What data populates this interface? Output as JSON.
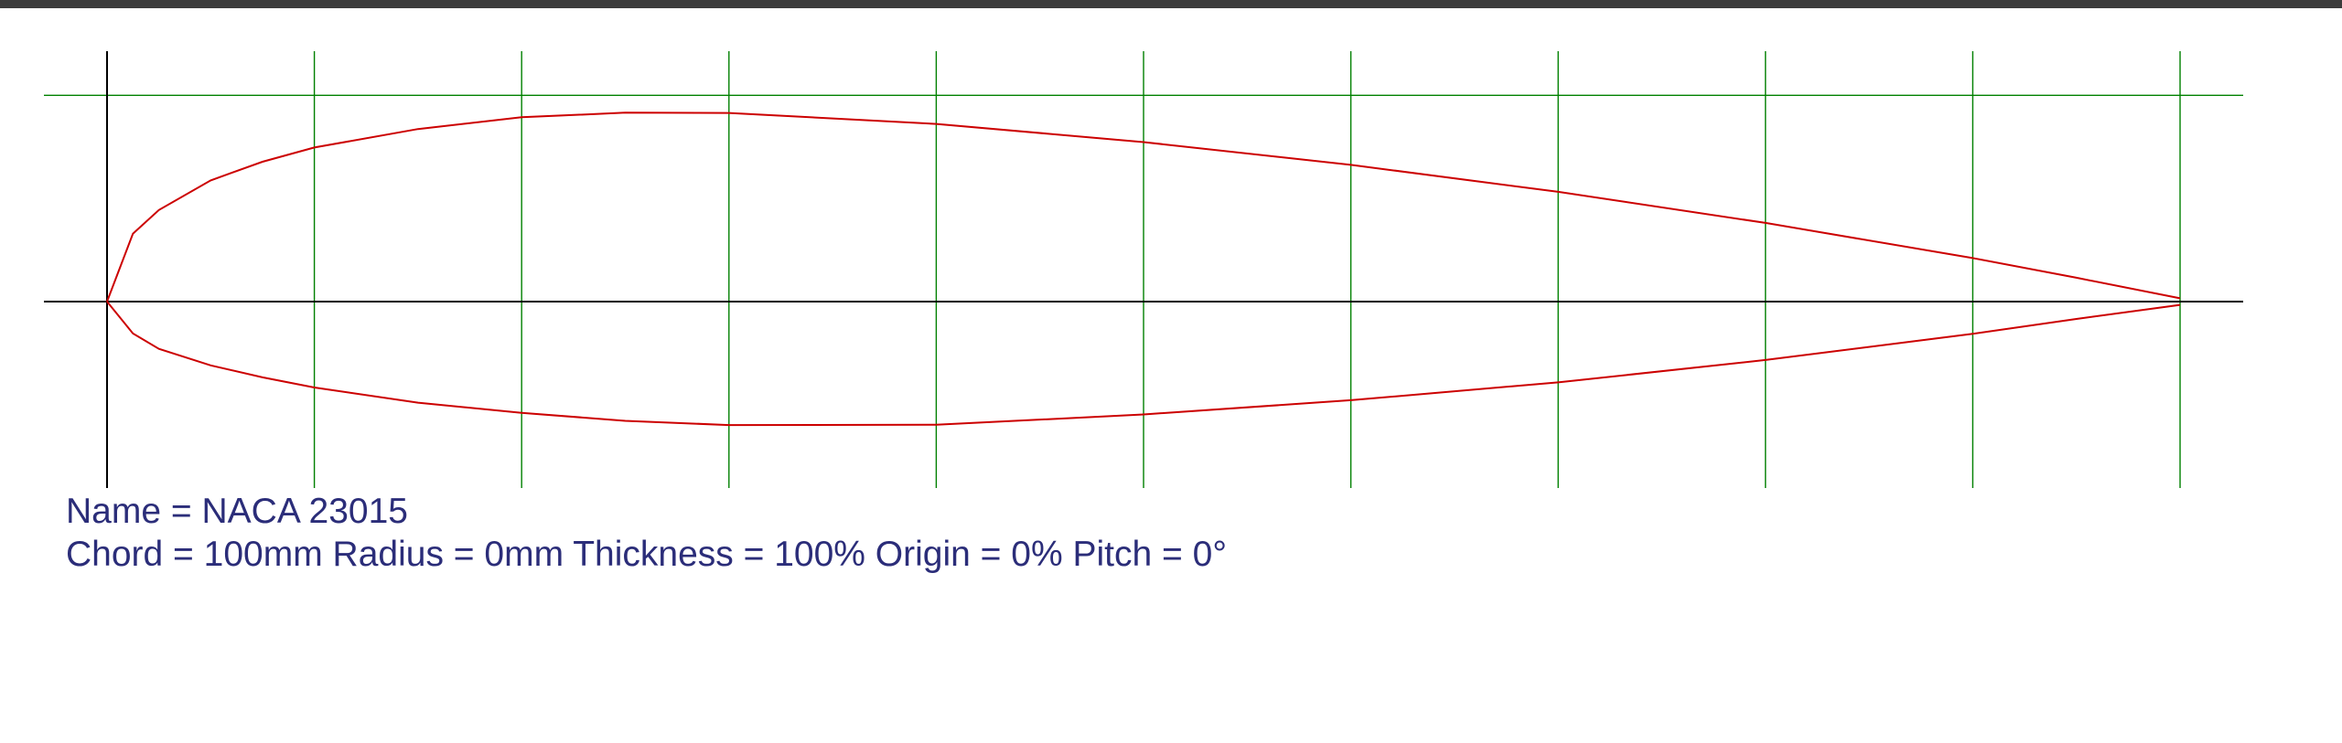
{
  "airfoil": {
    "name_label": "Name = ",
    "name": "NACA 23015",
    "chord_label": "Chord = ",
    "chord": "100mm",
    "radius_label": " Radius = ",
    "radius": "0mm",
    "thickness_label": " Thickness = ",
    "thickness": "100%",
    "origin_label": " Origin = ",
    "origin": "0%",
    "pitch_label": " Pitch = ",
    "pitch": "0°"
  },
  "colors": {
    "profile": "#cc0000",
    "grid": "#008000",
    "axis": "#000000",
    "text": "#2b2d79",
    "topbar": "#3c3c3c"
  },
  "profile": {
    "x_range": [
      0,
      100
    ],
    "grid_x_step": 10,
    "max_thickness_line_y": 9.96,
    "upper": [
      [
        0,
        0
      ],
      [
        1.25,
        3.28
      ],
      [
        2.5,
        4.42
      ],
      [
        5,
        5.85
      ],
      [
        7.5,
        6.75
      ],
      [
        10,
        7.44
      ],
      [
        15,
        8.33
      ],
      [
        20,
        8.9
      ],
      [
        25,
        9.12
      ],
      [
        30,
        9.11
      ],
      [
        40,
        8.58
      ],
      [
        50,
        7.7
      ],
      [
        60,
        6.6
      ],
      [
        70,
        5.3
      ],
      [
        80,
        3.8
      ],
      [
        90,
        2.1
      ],
      [
        95,
        1.15
      ],
      [
        100,
        0.16
      ]
    ],
    "lower": [
      [
        0,
        0
      ],
      [
        1.25,
        -1.54
      ],
      [
        2.5,
        -2.28
      ],
      [
        5,
        -3.08
      ],
      [
        7.5,
        -3.66
      ],
      [
        10,
        -4.15
      ],
      [
        15,
        -4.88
      ],
      [
        20,
        -5.37
      ],
      [
        25,
        -5.76
      ],
      [
        30,
        -5.96
      ],
      [
        40,
        -5.95
      ],
      [
        50,
        -5.45
      ],
      [
        60,
        -4.76
      ],
      [
        70,
        -3.9
      ],
      [
        80,
        -2.82
      ],
      [
        90,
        -1.56
      ],
      [
        95,
        -0.84
      ],
      [
        100,
        -0.16
      ]
    ]
  }
}
